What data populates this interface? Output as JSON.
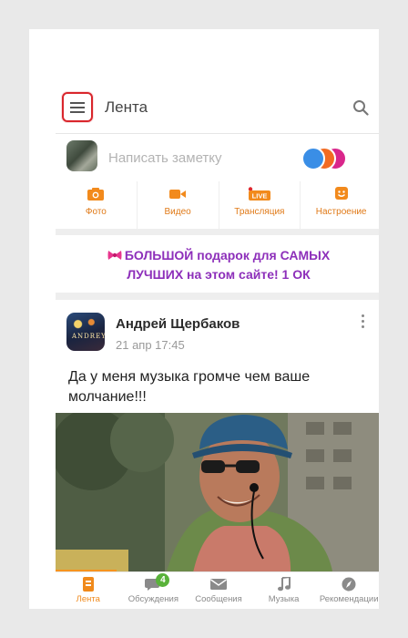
{
  "header": {
    "title": "Лента",
    "menu_icon": "hamburger-menu-icon",
    "search_icon": "search-icon",
    "highlight_color": "#d9262c"
  },
  "compose": {
    "placeholder": "Написать заметку"
  },
  "actions": [
    {
      "label": "Фото",
      "icon": "camera-icon"
    },
    {
      "label": "Видео",
      "icon": "video-camera-icon"
    },
    {
      "label": "Трансляция",
      "icon": "live-broadcast-icon",
      "badge": "LIVE"
    },
    {
      "label": "Настроение",
      "icon": "smiley-icon"
    }
  ],
  "promo": {
    "line1": "БОЛЬШОЙ подарок для САМЫХ",
    "line2": "ЛУЧШИХ на этом сайте! 1 ОК",
    "icon": "gift-bow-icon",
    "color": "#8d2fba"
  },
  "post": {
    "author": "Андрей Щербаков",
    "date": "21 апр 17:45",
    "text": "Да у меня музыка громче чем ваше молчание!!!",
    "avatar_text": "ANDREY"
  },
  "bottom_nav": [
    {
      "label": "Лента",
      "icon": "feed-icon",
      "active": true
    },
    {
      "label": "Обсуждения",
      "icon": "chat-bubble-icon",
      "badge": "4"
    },
    {
      "label": "Сообщения",
      "icon": "envelope-icon"
    },
    {
      "label": "Музыка",
      "icon": "music-note-icon"
    },
    {
      "label": "Рекомендации",
      "icon": "compass-icon"
    }
  ],
  "accent_color": "#f7931e"
}
